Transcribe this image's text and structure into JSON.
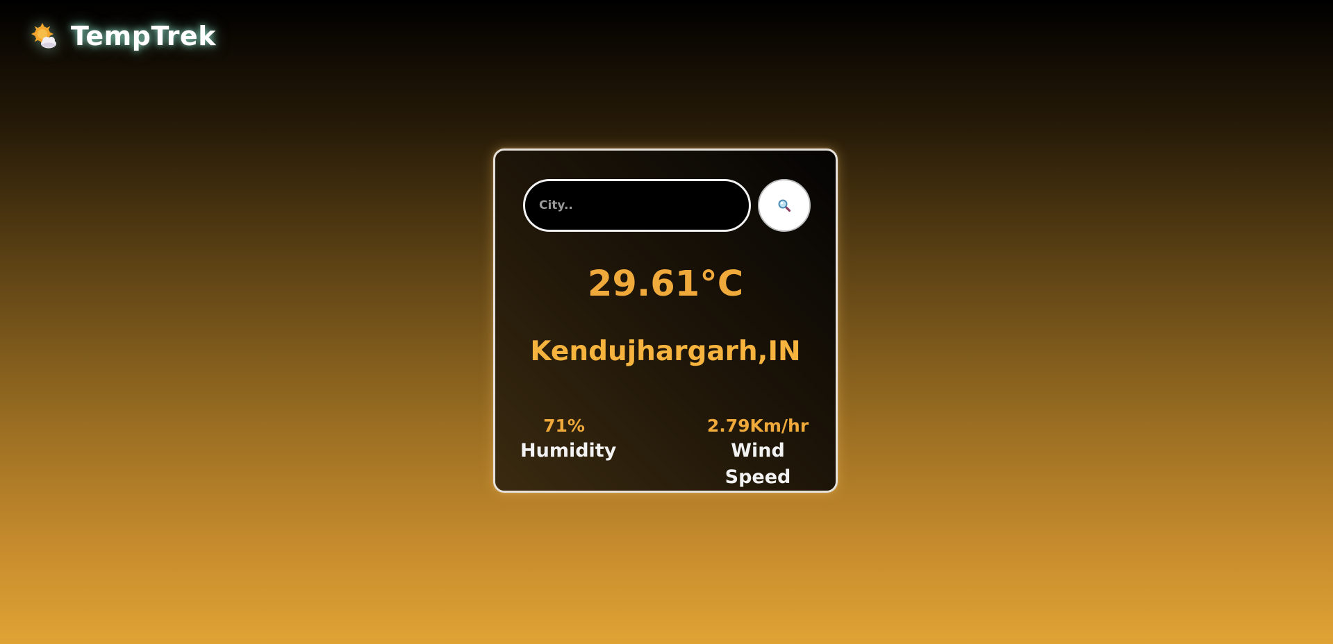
{
  "app": {
    "title": "TempTrek",
    "logo_icon": "sun-behind-cloud-icon"
  },
  "search": {
    "placeholder": "City..",
    "value": "",
    "button_icon": "magnifying-glass-icon"
  },
  "weather": {
    "temperature": "29.61°C",
    "location": "Kendujhargarh,IN",
    "humidity": {
      "value": "71%",
      "label": "Humidity"
    },
    "wind": {
      "value": "2.79Km/hr",
      "label": "Wind Speed"
    }
  },
  "colors": {
    "accent": "#f0a93b",
    "background_top": "#000000",
    "background_bottom": "#dfa334",
    "card_border": "#e6e2db"
  }
}
